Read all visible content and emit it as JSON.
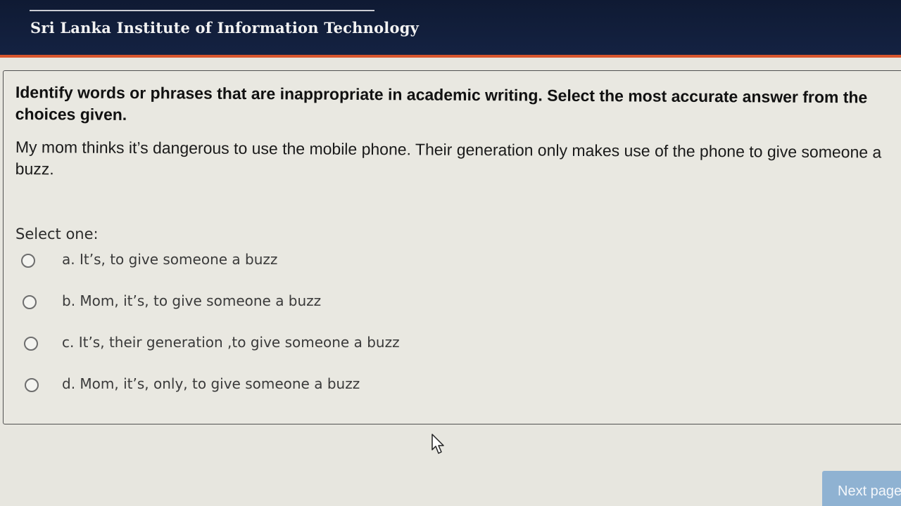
{
  "header": {
    "institution": "Sri Lanka Institute of Information Technology",
    "background_color": "#142242",
    "accent_color": "#d9562e"
  },
  "question": {
    "instruction": "Identify words or phrases that are inappropriate in academic writing. Select the most accurate answer from the choices given.",
    "prompt": "My mom thinks it’s dangerous to use the mobile phone. Their generation only makes use of the phone to give someone a buzz.",
    "select_label": "Select one:",
    "options": [
      {
        "label": "a. It’s, to give someone a buzz",
        "selected": false
      },
      {
        "label": "b. Mom, it’s, to give someone a buzz",
        "selected": false
      },
      {
        "label": "c. It’s, their generation ,to give someone a buzz",
        "selected": false
      },
      {
        "label": "d. Mom, it’s, only, to give someone a buzz",
        "selected": false
      }
    ]
  },
  "navigation": {
    "next_label": "Next page",
    "button_color": "#8fb2d2"
  },
  "icons": {
    "cursor": "mouse-pointer-icon",
    "radio": "radio-circle-icon"
  }
}
